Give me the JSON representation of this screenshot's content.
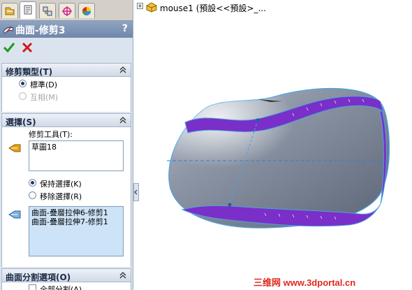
{
  "tabs": [
    "feature-manager",
    "property-manager",
    "configuration-manager",
    "dimxpert-manager",
    "display-manager"
  ],
  "title": "曲面-修剪3",
  "help_label": "?",
  "trim_type": {
    "header": "修剪類型(T)",
    "options": [
      {
        "label": "標準(D)",
        "selected": true,
        "enabled": true
      },
      {
        "label": "互相(M)",
        "selected": false,
        "enabled": false
      }
    ]
  },
  "selections": {
    "header": "選擇(S)",
    "trim_tool_label": "修剪工具(T):",
    "trim_tool_items": [
      "草圖18"
    ],
    "keep_option": "保持選擇(K)",
    "remove_option": "移除選擇(R)",
    "keep_selected": true,
    "pieces": [
      "曲面-疊層拉伸6-修剪1",
      "曲面-疊層拉伸7-修剪1"
    ]
  },
  "split_options": {
    "header": "曲面分割選項(O)",
    "split_all_label": "全部分割(A)"
  },
  "tree": {
    "expand": "+",
    "root_label": "mouse1  (預設<<預設>_..."
  },
  "watermark": "三维网 www.3dportal.cn",
  "colors": {
    "accent_purple": "#7a2fc8",
    "edge_blue": "#4aa3e0",
    "body_gray": "#8a93a3",
    "ok_green": "#1c9a1c",
    "cancel_red": "#d01818"
  }
}
